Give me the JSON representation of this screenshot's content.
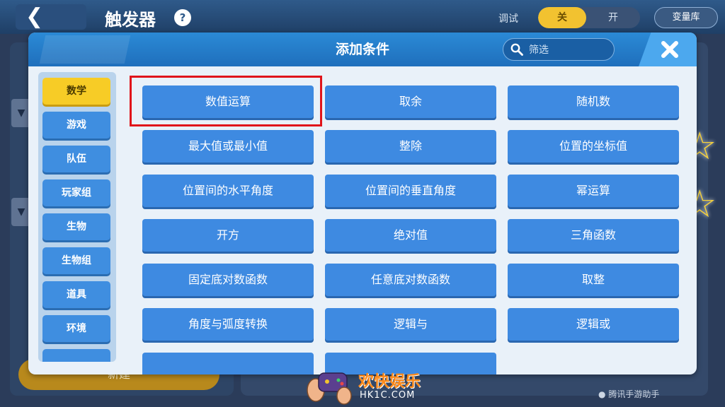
{
  "background": {
    "back_icon": "arrow-left-icon",
    "title": "触发器",
    "debug_label": "调试",
    "toggle_off": "关",
    "toggle_on": "开",
    "variable_library": "变量库",
    "create_label": "新建"
  },
  "modal": {
    "title": "添加条件",
    "search_placeholder": "筛选",
    "close_icon": "close-icon",
    "categories": [
      {
        "label": "数学",
        "active": true
      },
      {
        "label": "游戏",
        "active": false
      },
      {
        "label": "队伍",
        "active": false
      },
      {
        "label": "玩家组",
        "active": false
      },
      {
        "label": "生物",
        "active": false
      },
      {
        "label": "生物组",
        "active": false
      },
      {
        "label": "道具",
        "active": false
      },
      {
        "label": "环境",
        "active": false
      }
    ],
    "conditions": [
      "数值运算",
      "取余",
      "随机数",
      "最大值或最小值",
      "整除",
      "位置的坐标值",
      "位置间的水平角度",
      "位置间的垂直角度",
      "幂运算",
      "开方",
      "绝对值",
      "三角函数",
      "固定底对数函数",
      "任意底对数函数",
      "取整",
      "角度与弧度转换",
      "逻辑与",
      "逻辑或"
    ],
    "highlighted_condition": "数值运算"
  },
  "watermark": {
    "brand": "欢快娱乐",
    "site": "HK1C.COM",
    "helper": "腾讯手游助手"
  },
  "colors": {
    "header_blue": "#2b8ad6",
    "button_blue": "#3e8ae1",
    "active_yellow": "#f7cc26",
    "highlight_red": "#e0141a"
  }
}
